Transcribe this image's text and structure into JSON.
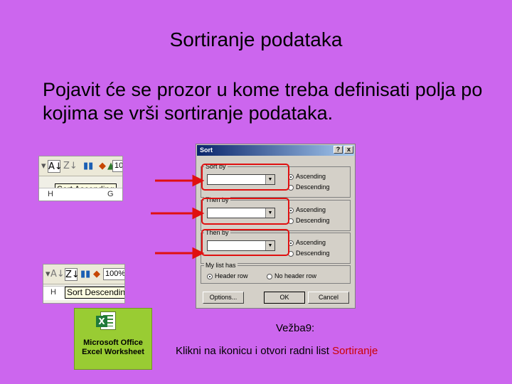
{
  "slide": {
    "title": "Sortiranje  podataka",
    "body": "Pojavit će se prozor u kome treba definisati polja po kojima se vrši sortiranje podataka."
  },
  "toolbar_top": {
    "zoom": "10",
    "tooltip": "Sort Ascending",
    "col_h": "H",
    "col_g": "G"
  },
  "toolbar_bottom": {
    "zoom": "100%",
    "tooltip": "Sort Descending",
    "col_h": "H"
  },
  "excel_icon": {
    "label": "Microsoft Office Excel Worksheet"
  },
  "sort_dialog": {
    "title": "Sort",
    "help_button": "?",
    "close_button": "x",
    "group1_label": "Sort by",
    "group2_label": "Then by",
    "group3_label": "Then by",
    "ascending": "Ascending",
    "descending": "Descending",
    "list_label": "My list has",
    "header_row": "Header row",
    "no_header_row": "No header row",
    "options_button": "Options...",
    "ok_button": "OK",
    "cancel_button": "Cancel"
  },
  "footer": {
    "heading": "Vežba9:",
    "instruction": "Klikni na ikonicu i otvori radni list ",
    "highlight": "Sortiranje"
  },
  "colors": {
    "background": "#cc66ee",
    "highlight": "#cc0000",
    "arrow": "#e01010",
    "dialog_title": "#0a246a"
  }
}
